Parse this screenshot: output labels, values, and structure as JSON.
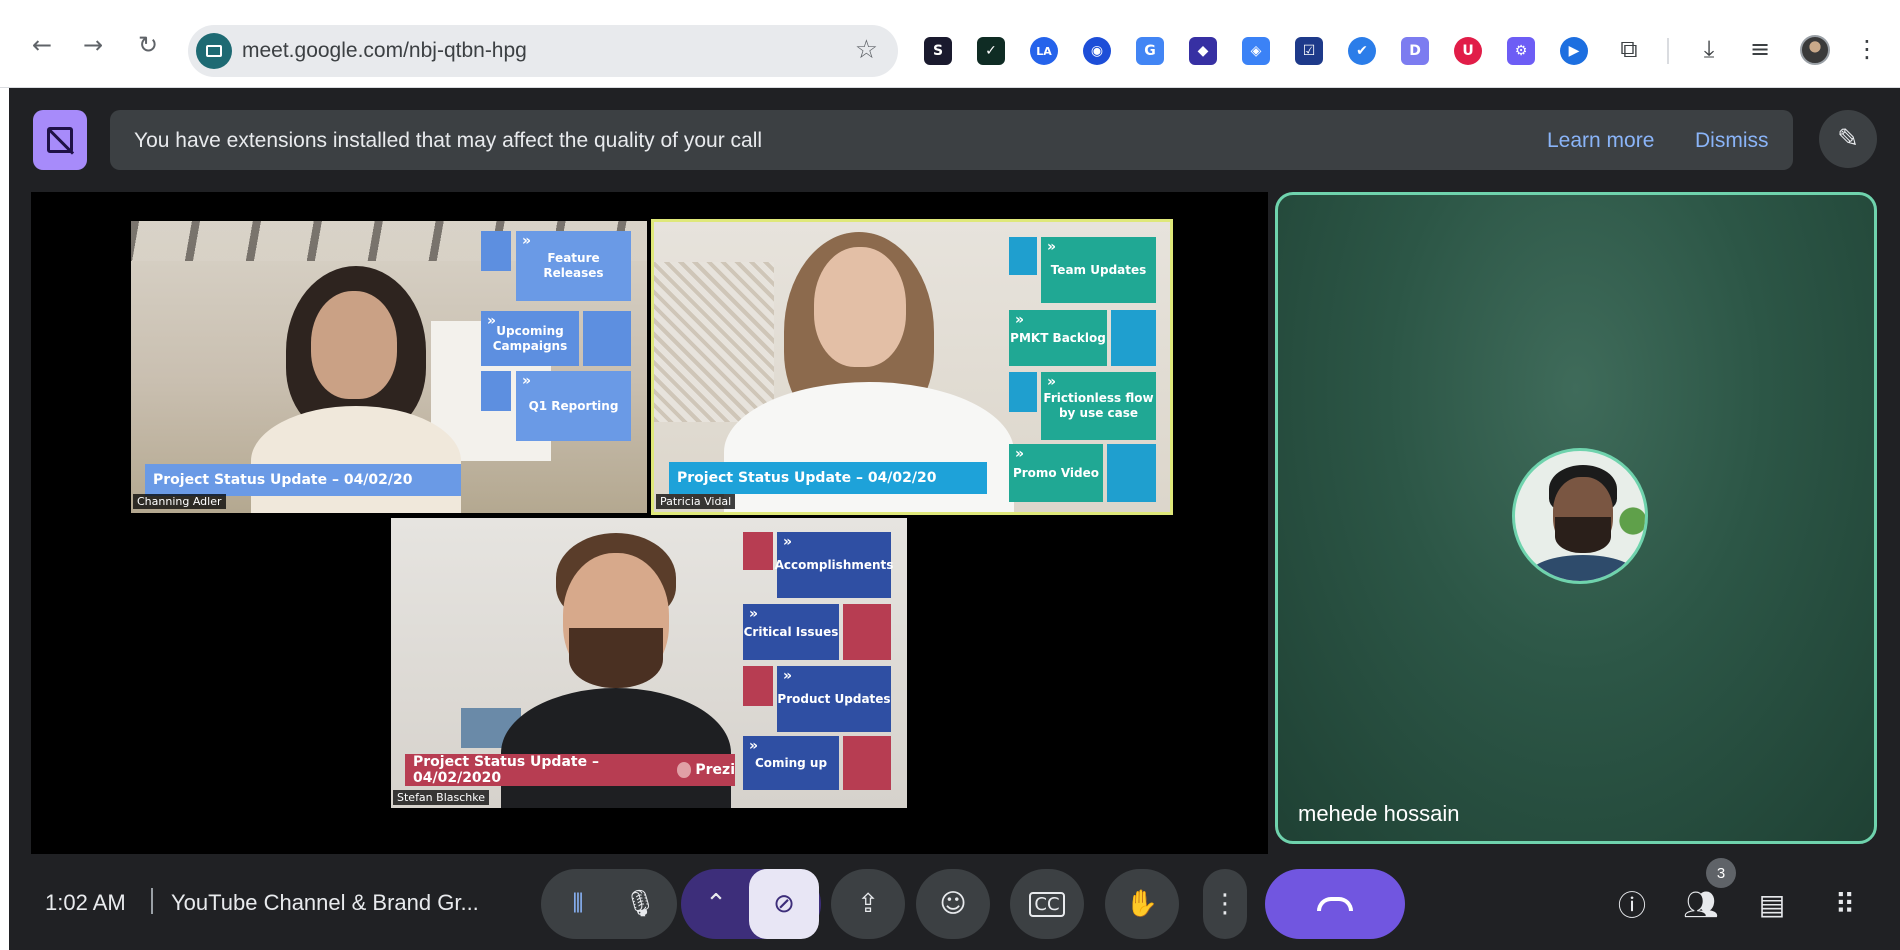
{
  "browser": {
    "url": "meet.google.com/nbj-qtbn-hpg",
    "back_icon": "arrow-left-icon",
    "forward_icon": "arrow-right-icon",
    "reload_icon": "reload-icon",
    "star_icon": "star-icon",
    "extensions": [
      {
        "icon": "extension-s-icon",
        "color": "#1a1a2e",
        "glyph": "S"
      },
      {
        "icon": "extension-check-terminal-icon",
        "color": "#0f2c24",
        "glyph": "✓"
      },
      {
        "icon": "extension-la-icon",
        "color": "#2563eb",
        "glyph": "LA"
      },
      {
        "icon": "extension-globe-icon",
        "color": "#1d4ed8",
        "glyph": "◉"
      },
      {
        "icon": "extension-translate-icon",
        "color": "#4285f4",
        "glyph": "G"
      },
      {
        "icon": "extension-diamond-icon",
        "color": "#3730a3",
        "glyph": "◆"
      },
      {
        "icon": "extension-tag-icon",
        "color": "#3b82f6",
        "glyph": "◈"
      },
      {
        "icon": "extension-checkbox-icon",
        "color": "#1e3a8a",
        "glyph": "☑"
      },
      {
        "icon": "extension-badge-check-icon",
        "color": "#2b7de9",
        "glyph": "✔"
      },
      {
        "icon": "extension-d-icon",
        "color": "#7c7cf0",
        "glyph": "D"
      },
      {
        "icon": "extension-shield-u-icon",
        "color": "#e11d48",
        "glyph": "U"
      },
      {
        "icon": "extension-gear-icon",
        "color": "#6d5df5",
        "glyph": "⚙"
      },
      {
        "icon": "extension-play-icon",
        "color": "#1d6fe0",
        "glyph": "▶"
      }
    ],
    "puzzle_icon": "puzzle-icon",
    "download_icon": "download-icon",
    "media_icon": "media-control-icon",
    "profile_icon": "profile-avatar-icon",
    "menu_icon": "more-vertical-icon"
  },
  "banner": {
    "text": "You have extensions installed that may affect the quality of your call",
    "learn_more": "Learn more",
    "dismiss": "Dismiss",
    "extension_icon": "extension-warning-icon",
    "effects_icon": "pen-effects-icon"
  },
  "stage": {
    "tiles": [
      {
        "name": "Channing Adler",
        "caption": "Project Status Update – 04/02/20",
        "boxes": [
          "Feature Releases",
          "Upcoming Campaigns",
          "Q1 Reporting"
        ]
      },
      {
        "name": "Patricia Vidal",
        "caption": "Project Status Update – 04/02/20",
        "boxes": [
          "Team Updates",
          "PMKT Backlog",
          "Frictionless flow by use case",
          "Promo Video"
        ]
      },
      {
        "name": "Stefan Blaschke",
        "caption": "Project Status Update – 04/02/2020",
        "caption_brand": "Prezi",
        "boxes": [
          "Accomplishments",
          "Critical Issues",
          "Product Updates",
          "Coming up"
        ]
      }
    ]
  },
  "self": {
    "name": "mehede hossain"
  },
  "bottom": {
    "time": "1:02 AM",
    "meeting_title": "YouTube Channel & Brand Gr...",
    "participant_count": "3",
    "icons": {
      "audio_level": "audio-level-icon",
      "mic": "microphone-icon",
      "camera_options": "chevron-up-icon",
      "camera_off": "camera-off-icon",
      "present": "present-screen-icon",
      "reactions": "emoji-icon",
      "captions": "captions-icon",
      "raise_hand": "raise-hand-icon",
      "more": "more-vertical-icon",
      "end_call": "end-call-icon",
      "info": "info-icon",
      "people": "people-icon",
      "chat": "chat-icon",
      "activities": "apps-grid-icon"
    }
  }
}
